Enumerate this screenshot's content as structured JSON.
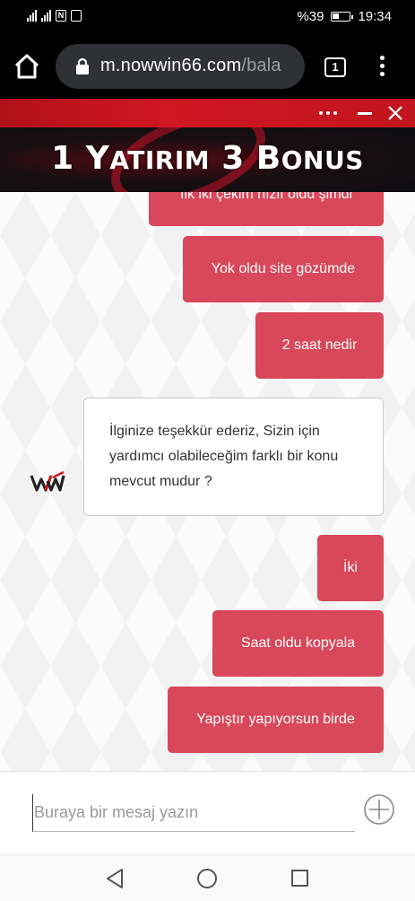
{
  "status_bar": {
    "battery_percent": "%39",
    "time": "19:34",
    "nfc_label": "N"
  },
  "browser": {
    "url_domain": "m.nowwin66.com",
    "url_path": "/bala",
    "tab_count": "1"
  },
  "banner": {
    "title_num1": "1 Y",
    "title_word1": "ATIRIM",
    "title_num2": " 3 B",
    "title_word2": "ONUS",
    "accent_color": "#d01722"
  },
  "chat": {
    "outgoing_color": "#d9475a",
    "messages": [
      {
        "direction": "out",
        "text": "İlk iki çekim hızlı oldu şimdi"
      },
      {
        "direction": "out",
        "text": "Yok oldu site gözümde"
      },
      {
        "direction": "out",
        "text": "2 saat nedir"
      },
      {
        "direction": "in",
        "text": "İlginize teşekkür ederiz, Sizin için yardımcı olabileceğim farklı bir konu mevcut mudur ?"
      },
      {
        "direction": "out",
        "text": "İki"
      },
      {
        "direction": "out",
        "text": "Saat oldu kopyala"
      },
      {
        "direction": "out",
        "text": "Yapıştır yapıyorsun birde"
      }
    ]
  },
  "composer": {
    "placeholder": "Buraya bir mesaj yazın",
    "value": ""
  },
  "icons": {
    "home": "home-icon",
    "lock": "lock-icon",
    "menu": "more-vert-icon",
    "close": "close-icon",
    "minimize": "minimize-icon",
    "more": "more-horiz-icon",
    "plus": "add-circle-icon",
    "avatar": "ww-logo-icon",
    "back": "back-icon",
    "nav_home": "nav-home-icon",
    "recent": "recent-apps-icon"
  }
}
